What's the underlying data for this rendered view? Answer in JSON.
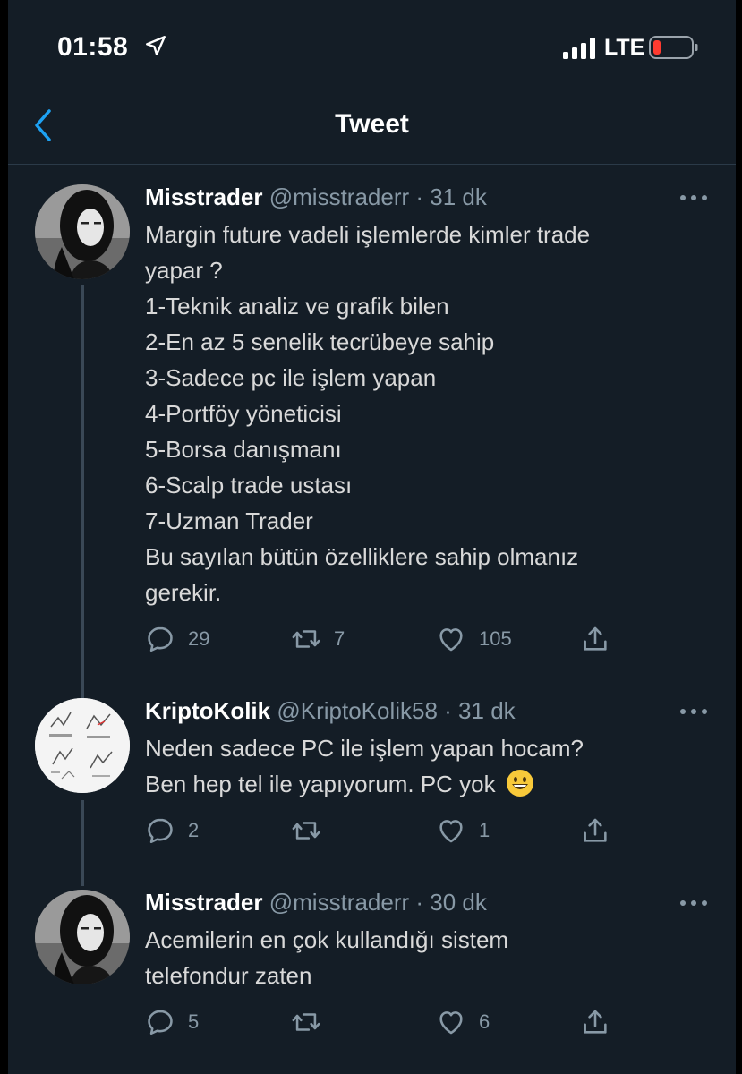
{
  "status": {
    "time": "01:58",
    "network": "LTE"
  },
  "header": {
    "title": "Tweet"
  },
  "tweets": [
    {
      "name": "Misstrader",
      "handle": "@misstraderr",
      "time": "31 dk",
      "lines": [
        "Margin future vadeli işlemlerde kimler trade",
        "yapar ?",
        "1-Teknik analiz ve grafik bilen",
        "2-En az 5 senelik tecrübeye sahip",
        "3-Sadece pc ile işlem yapan",
        "4-Portföy yöneticisi",
        "5-Borsa danışmanı",
        "6-Scalp trade ustası",
        "7-Uzman Trader",
        "Bu sayılan bütün özelliklere sahip olmanız",
        "gerekir."
      ],
      "replies": "29",
      "retweets": "7",
      "likes": "105"
    },
    {
      "name": "KriptoKolik",
      "handle": "@KriptoKolik58",
      "time": "31 dk",
      "lines": [
        "Neden sadece PC ile işlem yapan hocam?",
        "Ben hep tel ile yapıyorum. PC yok"
      ],
      "replies": "2",
      "retweets": "",
      "likes": "1"
    },
    {
      "name": "Misstrader",
      "handle": "@misstraderr",
      "time": "30 dk",
      "lines": [
        "Acemilerin en çok kullandığı sistem",
        "telefondur zaten"
      ],
      "replies": "5",
      "retweets": "",
      "likes": "6"
    }
  ],
  "icons": {
    "reply": "reply-icon",
    "retweet": "retweet-icon",
    "like": "heart-icon",
    "share": "share-icon",
    "more": "more-icon"
  },
  "colors": {
    "background": "#141d26",
    "accent": "#1da1f2",
    "muted": "#8899a6",
    "battery_low": "#ff3b30"
  }
}
